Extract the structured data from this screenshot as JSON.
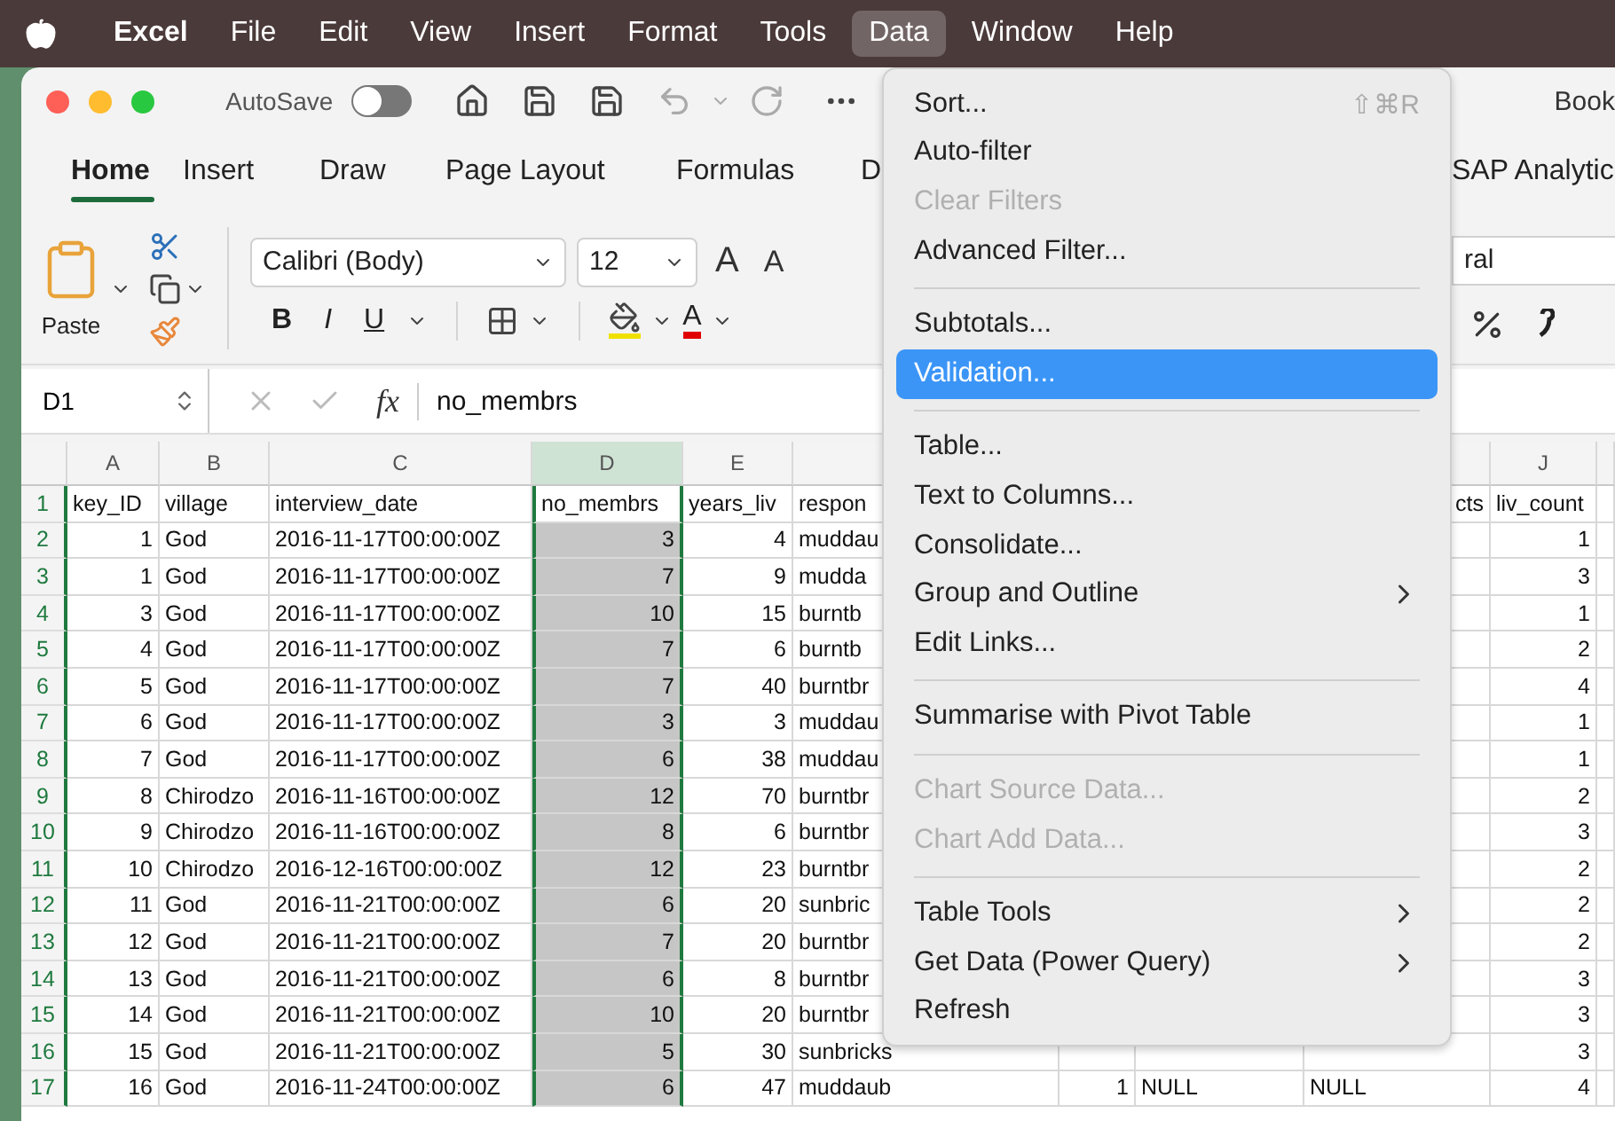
{
  "menubar": {
    "items": [
      {
        "label": "Excel",
        "bold": true,
        "selected": false
      },
      {
        "label": "File",
        "selected": false
      },
      {
        "label": "Edit",
        "selected": false
      },
      {
        "label": "View",
        "selected": false
      },
      {
        "label": "Insert",
        "selected": false
      },
      {
        "label": "Format",
        "selected": false
      },
      {
        "label": "Tools",
        "selected": false
      },
      {
        "label": "Data",
        "selected": true
      },
      {
        "label": "Window",
        "selected": false
      },
      {
        "label": "Help",
        "selected": false
      }
    ]
  },
  "window": {
    "title": "Book",
    "autosave": {
      "label": "AutoSave",
      "on": false
    }
  },
  "ribbon_tabs": [
    {
      "label": "Home",
      "selected": true
    },
    {
      "label": "Insert",
      "selected": false
    },
    {
      "label": "Draw",
      "selected": false
    },
    {
      "label": "Page Layout",
      "selected": false
    },
    {
      "label": "Formulas",
      "selected": false
    },
    {
      "label": "D",
      "selected": false
    },
    {
      "label": "SAP Analytic",
      "selected": false
    }
  ],
  "ribbon": {
    "paste_label": "Paste",
    "font_name": "Calibri (Body)",
    "font_size": "12",
    "grow_font": "A",
    "shrink_font": "A",
    "format_buttons": [
      "B",
      "I",
      "U"
    ],
    "font_color": "A",
    "number_format": "ral"
  },
  "formula_bar": {
    "name_box": "D1",
    "fx": "fx",
    "formula": "no_membrs"
  },
  "sheet": {
    "columns": [
      {
        "label": "A",
        "selected": false
      },
      {
        "label": "B",
        "selected": false
      },
      {
        "label": "C",
        "selected": false
      },
      {
        "label": "D",
        "selected": true
      },
      {
        "label": "E",
        "selected": false
      },
      {
        "selected": false
      },
      {
        "selected": false
      },
      {
        "selected": false
      },
      {
        "selected": false
      },
      {
        "label": "J",
        "selected": false
      },
      {
        "selected": false
      }
    ],
    "rows": [
      {
        "label": "1",
        "cells": [
          "key_ID",
          "village",
          "interview_date",
          "no_membrs",
          "years_liv",
          "respon",
          null,
          null,
          "cts",
          "liv_count",
          null
        ]
      },
      {
        "label": "2",
        "cells": [
          "1",
          "God",
          "2016-11-17T00:00:00Z",
          "3",
          "4",
          "muddau",
          null,
          null,
          null,
          "1",
          null
        ]
      },
      {
        "label": "3",
        "cells": [
          "1",
          "God",
          "2016-11-17T00:00:00Z",
          "7",
          "9",
          "mudda",
          null,
          null,
          null,
          "3",
          null
        ]
      },
      {
        "label": "4",
        "cells": [
          "3",
          "God",
          "2016-11-17T00:00:00Z",
          "10",
          "15",
          "burntb",
          null,
          null,
          null,
          "1",
          null
        ]
      },
      {
        "label": "5",
        "cells": [
          "4",
          "God",
          "2016-11-17T00:00:00Z",
          "7",
          "6",
          "burntb",
          null,
          null,
          null,
          "2",
          null
        ]
      },
      {
        "label": "6",
        "cells": [
          "5",
          "God",
          "2016-11-17T00:00:00Z",
          "7",
          "40",
          "burntbr",
          null,
          null,
          null,
          "4",
          null
        ]
      },
      {
        "label": "7",
        "cells": [
          "6",
          "God",
          "2016-11-17T00:00:00Z",
          "3",
          "3",
          "muddau",
          null,
          null,
          null,
          "1",
          null
        ]
      },
      {
        "label": "8",
        "cells": [
          "7",
          "God",
          "2016-11-17T00:00:00Z",
          "6",
          "38",
          "muddau",
          null,
          null,
          null,
          "1",
          null
        ]
      },
      {
        "label": "9",
        "cells": [
          "8",
          "Chirodzo",
          "2016-11-16T00:00:00Z",
          "12",
          "70",
          "burntbr",
          null,
          null,
          null,
          "2",
          null
        ]
      },
      {
        "label": "10",
        "cells": [
          "9",
          "Chirodzo",
          "2016-11-16T00:00:00Z",
          "8",
          "6",
          "burntbr",
          null,
          null,
          null,
          "3",
          null
        ]
      },
      {
        "label": "11",
        "cells": [
          "10",
          "Chirodzo",
          "2016-12-16T00:00:00Z",
          "12",
          "23",
          "burntbr",
          null,
          null,
          null,
          "2",
          null
        ]
      },
      {
        "label": "12",
        "cells": [
          "11",
          "God",
          "2016-11-21T00:00:00Z",
          "6",
          "20",
          "sunbric",
          null,
          null,
          null,
          "2",
          null
        ]
      },
      {
        "label": "13",
        "cells": [
          "12",
          "God",
          "2016-11-21T00:00:00Z",
          "7",
          "20",
          "burntbr",
          null,
          null,
          null,
          "2",
          null
        ]
      },
      {
        "label": "14",
        "cells": [
          "13",
          "God",
          "2016-11-21T00:00:00Z",
          "6",
          "8",
          "burntbr",
          null,
          null,
          null,
          "3",
          null
        ]
      },
      {
        "label": "15",
        "cells": [
          "14",
          "God",
          "2016-11-21T00:00:00Z",
          "10",
          "20",
          "burntbr",
          null,
          null,
          null,
          "3",
          null
        ]
      },
      {
        "label": "16",
        "cells": [
          "15",
          "God",
          "2016-11-21T00:00:00Z",
          "5",
          "30",
          "sunbricks",
          null,
          null,
          null,
          "3",
          null
        ]
      },
      {
        "label": "17",
        "cells": [
          "16",
          "God",
          "2016-11-24T00:00:00Z",
          "6",
          "47",
          "muddaub",
          "1",
          "NULL",
          "NULL",
          "4",
          null
        ]
      }
    ]
  },
  "dropdown_menu": {
    "items": [
      {
        "kind": "item",
        "label": "Sort...",
        "shortcut": "⇧⌘R",
        "disabled": false,
        "selected": false,
        "submenu": false
      },
      {
        "kind": "item",
        "label": "Auto-filter",
        "disabled": false,
        "selected": false,
        "submenu": false
      },
      {
        "kind": "item",
        "label": "Clear Filters",
        "disabled": true,
        "selected": false,
        "submenu": false
      },
      {
        "kind": "item",
        "label": "Advanced Filter...",
        "disabled": false,
        "selected": false,
        "submenu": false
      },
      {
        "kind": "separator"
      },
      {
        "kind": "item",
        "label": "Subtotals...",
        "disabled": false,
        "selected": false,
        "submenu": false
      },
      {
        "kind": "item",
        "label": "Validation...",
        "disabled": false,
        "selected": true,
        "submenu": false
      },
      {
        "kind": "separator"
      },
      {
        "kind": "item",
        "label": "Table...",
        "disabled": false,
        "selected": false,
        "submenu": false
      },
      {
        "kind": "item",
        "label": "Text to Columns...",
        "disabled": false,
        "selected": false,
        "submenu": false
      },
      {
        "kind": "item",
        "label": "Consolidate...",
        "disabled": false,
        "selected": false,
        "submenu": false
      },
      {
        "kind": "item",
        "label": "Group and Outline",
        "disabled": false,
        "selected": false,
        "submenu": true
      },
      {
        "kind": "item",
        "label": "Edit Links...",
        "disabled": false,
        "selected": false,
        "submenu": false
      },
      {
        "kind": "separator"
      },
      {
        "kind": "item",
        "label": "Summarise with Pivot Table",
        "disabled": false,
        "selected": false,
        "submenu": false
      },
      {
        "kind": "separator"
      },
      {
        "kind": "item",
        "label": "Chart Source Data...",
        "disabled": true,
        "selected": false,
        "submenu": false
      },
      {
        "kind": "item",
        "label": "Chart Add Data...",
        "disabled": true,
        "selected": false,
        "submenu": false
      },
      {
        "kind": "separator"
      },
      {
        "kind": "item",
        "label": "Table Tools",
        "disabled": false,
        "selected": false,
        "submenu": true
      },
      {
        "kind": "item",
        "label": "Get Data (Power Query)",
        "disabled": false,
        "selected": false,
        "submenu": true
      },
      {
        "kind": "item",
        "label": "Refresh",
        "disabled": false,
        "selected": false,
        "submenu": false
      }
    ]
  }
}
